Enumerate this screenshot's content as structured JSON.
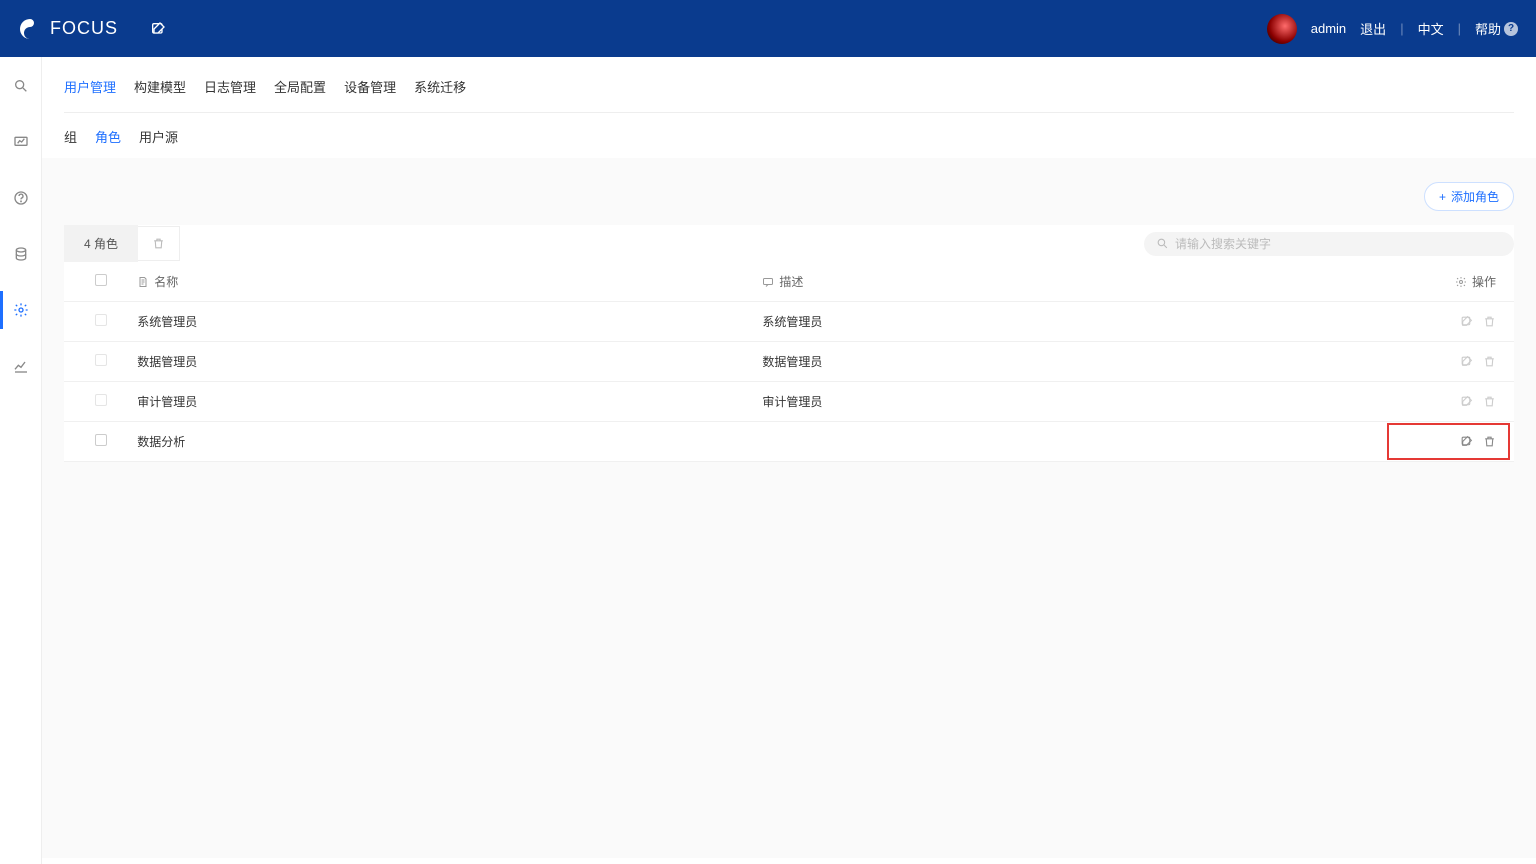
{
  "header": {
    "logo_text": "FOCUS",
    "username": "admin",
    "logout": "退出",
    "lang": "中文",
    "help": "帮助"
  },
  "topnav": {
    "items": [
      "用户管理",
      "构建模型",
      "日志管理",
      "全局配置",
      "设备管理",
      "系统迁移"
    ],
    "active_index": 0
  },
  "subtabs": {
    "items": [
      "组",
      "角色",
      "用户源"
    ],
    "active_index": 1
  },
  "toolbar": {
    "add_label": "添加角色",
    "count_label": "4 角色",
    "search_placeholder": "请输入搜索关键字"
  },
  "table": {
    "columns": {
      "name": "名称",
      "desc": "描述",
      "ops": "操作"
    },
    "rows": [
      {
        "name": "系统管理员",
        "desc": "系统管理员",
        "checkable": false,
        "ops_active": false,
        "highlight": false
      },
      {
        "name": "数据管理员",
        "desc": "数据管理员",
        "checkable": false,
        "ops_active": false,
        "highlight": false
      },
      {
        "name": "审计管理员",
        "desc": "审计管理员",
        "checkable": false,
        "ops_active": false,
        "highlight": false
      },
      {
        "name": "数据分析",
        "desc": "",
        "checkable": true,
        "ops_active": true,
        "highlight": true
      }
    ]
  }
}
